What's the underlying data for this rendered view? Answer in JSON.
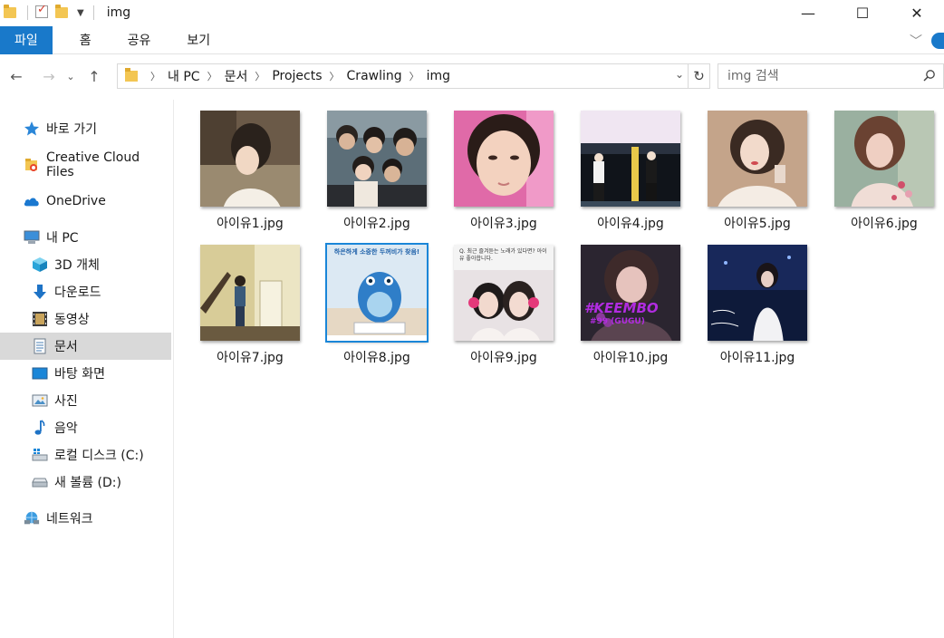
{
  "window": {
    "title": "img",
    "buttons": {
      "minimize": "—",
      "maximize": "☐",
      "close": "✕"
    }
  },
  "ribbon": {
    "tabs": [
      "파일",
      "홈",
      "공유",
      "보기"
    ]
  },
  "address": {
    "crumbs": [
      "내 PC",
      "문서",
      "Projects",
      "Crawling",
      "img"
    ]
  },
  "search": {
    "placeholder": "img 검색"
  },
  "sidebar": {
    "items": [
      {
        "label": "바로 가기",
        "icon": "star-icon"
      },
      {
        "label": "Creative Cloud Files",
        "icon": "creative-cloud-icon"
      },
      {
        "label": "OneDrive",
        "icon": "cloud-icon"
      },
      {
        "label": "내 PC",
        "icon": "computer-icon"
      },
      {
        "label": "3D 개체",
        "icon": "cube-icon"
      },
      {
        "label": "다운로드",
        "icon": "download-icon"
      },
      {
        "label": "동영상",
        "icon": "film-icon"
      },
      {
        "label": "문서",
        "icon": "document-icon",
        "selected": true
      },
      {
        "label": "바탕 화면",
        "icon": "desktop-icon"
      },
      {
        "label": "사진",
        "icon": "picture-icon"
      },
      {
        "label": "음악",
        "icon": "music-icon"
      },
      {
        "label": "로컬 디스크 (C:)",
        "icon": "drive-c-icon"
      },
      {
        "label": "새 볼륨 (D:)",
        "icon": "drive-icon"
      },
      {
        "label": "네트워크",
        "icon": "network-icon"
      }
    ]
  },
  "files": [
    {
      "name": "아이유1.jpg"
    },
    {
      "name": "아이유2.jpg"
    },
    {
      "name": "아이유3.jpg"
    },
    {
      "name": "아이유4.jpg"
    },
    {
      "name": "아이유5.jpg"
    },
    {
      "name": "아이유6.jpg"
    },
    {
      "name": "아이유7.jpg"
    },
    {
      "name": "아이유8.jpg",
      "caption": "하은하게 소중한 두꺼비가 찾음!"
    },
    {
      "name": "아이유9.jpg",
      "caption": "Q. 최근 즐겨듣는 노래가 있다면? 아이유 좋아합니다."
    },
    {
      "name": "아이유10.jpg",
      "caption": "#KEEMBO",
      "subcaption": "#99 (GUGU)"
    },
    {
      "name": "아이유11.jpg"
    }
  ],
  "colors": {
    "accent": "#1979ca",
    "selected_bg": "#d9d9d9",
    "folder": "#f3c653"
  }
}
